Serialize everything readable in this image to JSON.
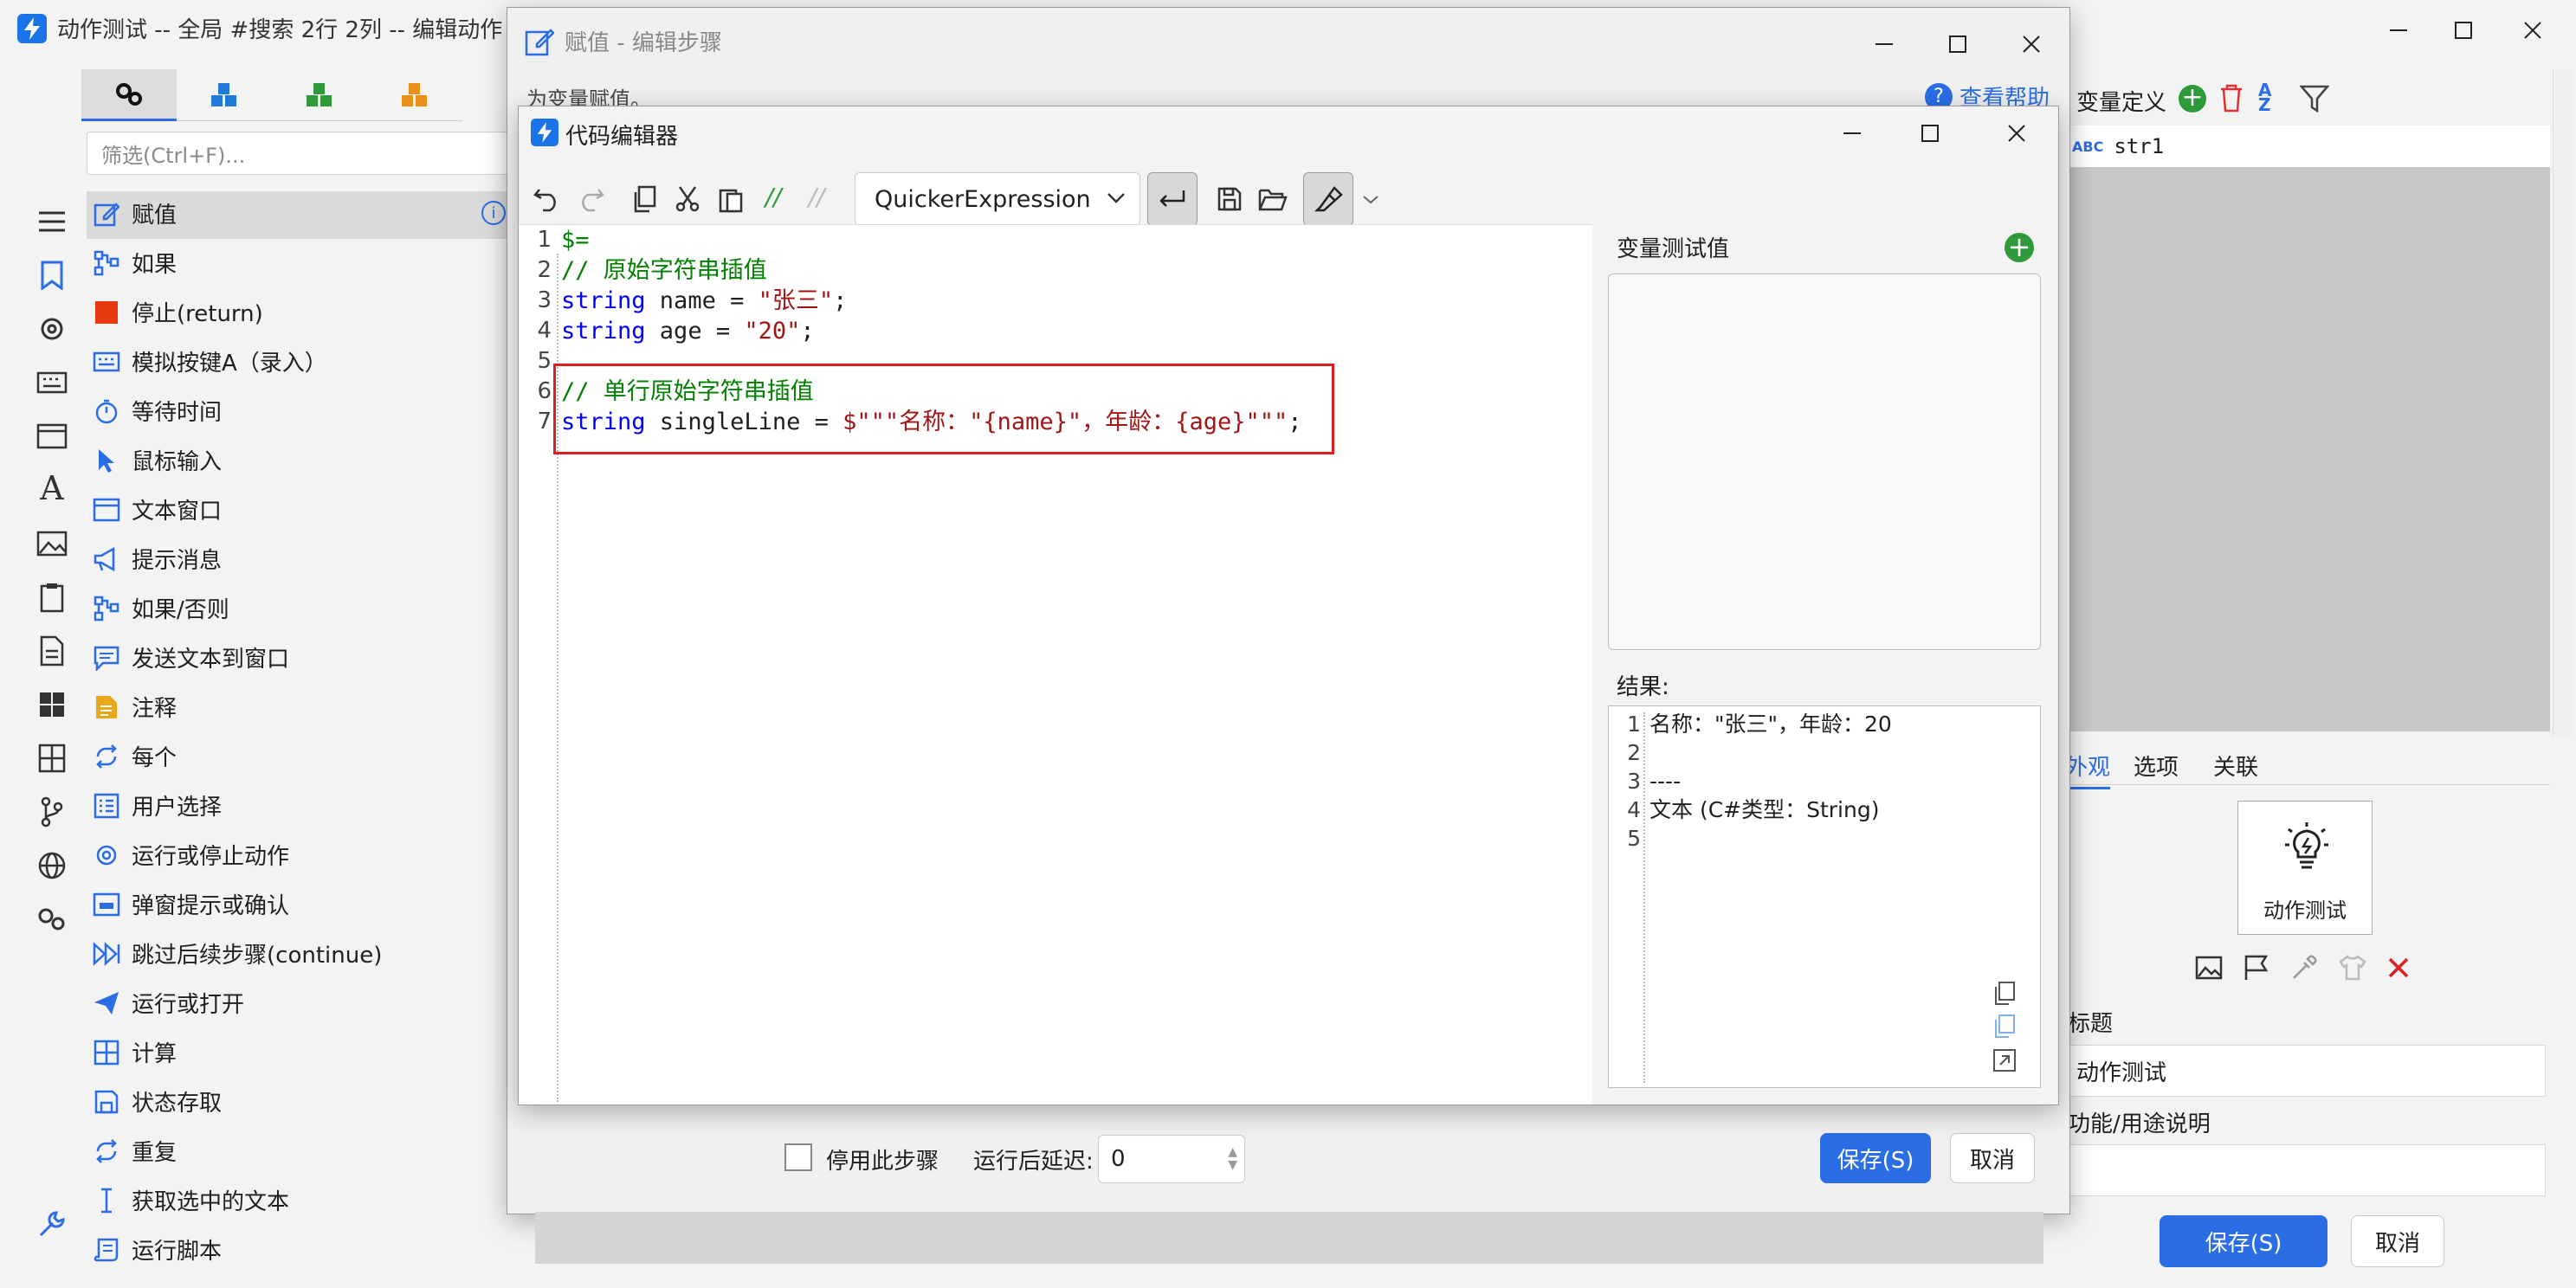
{
  "main_window": {
    "title": "动作测试 -- 全局 #搜索 2行 2列 -- 编辑动作",
    "filter_placeholder": "筛选(Ctrl+F)...",
    "toolbox_tabs": [
      "gears-tab",
      "cubes-blue-tab",
      "cubes-green-tab",
      "cubes-orange-tab"
    ],
    "steps": [
      {
        "label": "赋值",
        "icon": "pencil-icon"
      },
      {
        "label": "如果",
        "icon": "branch-icon"
      },
      {
        "label": "停止(return)",
        "icon": "stop-icon"
      },
      {
        "label": "模拟按键A（录入）",
        "icon": "keyboard-icon"
      },
      {
        "label": "等待时间",
        "icon": "timer-icon"
      },
      {
        "label": "鼠标输入",
        "icon": "cursor-icon"
      },
      {
        "label": "文本窗口",
        "icon": "window-icon"
      },
      {
        "label": "提示消息",
        "icon": "megaphone-icon"
      },
      {
        "label": "如果/否则",
        "icon": "branch-icon"
      },
      {
        "label": "发送文本到窗口",
        "icon": "message-icon"
      },
      {
        "label": "注释",
        "icon": "note-icon"
      },
      {
        "label": "每个",
        "icon": "loop-icon"
      },
      {
        "label": "用户选择",
        "icon": "list-icon"
      },
      {
        "label": "运行或停止动作",
        "icon": "gear-icon"
      },
      {
        "label": "弹窗提示或确认",
        "icon": "dialog-icon"
      },
      {
        "label": "跳过后续步骤(continue)",
        "icon": "skip-icon"
      },
      {
        "label": "运行或打开",
        "icon": "send-icon"
      },
      {
        "label": "计算",
        "icon": "calculator-icon"
      },
      {
        "label": "状态存取",
        "icon": "save-icon"
      },
      {
        "label": "重复",
        "icon": "loop-icon"
      },
      {
        "label": "获取选中的文本",
        "icon": "text-cursor-icon"
      },
      {
        "label": "运行脚本",
        "icon": "script-icon"
      }
    ],
    "var_panel_title": "变量定义",
    "variables": [
      {
        "type_badge": "ABC",
        "name": "str1"
      }
    ],
    "tabs": [
      "外观",
      "选项",
      "关联"
    ],
    "action_button_label": "动作测试",
    "title_label": "标题",
    "title_value": "动作测试",
    "desc_label": "功能/用途说明",
    "save": "保存(S)",
    "cancel": "取消"
  },
  "step_dialog": {
    "title": "赋值  -  编辑步骤",
    "subtitle": "为变量赋值。",
    "help_link": "查看帮助",
    "disable_step": "停用此步骤",
    "delay_label": "运行后延迟:",
    "delay_value": "0",
    "save": "保存(S)",
    "cancel": "取消"
  },
  "code_editor": {
    "title": "代码编辑器",
    "language": "QuickerExpression",
    "comment_btn": "//",
    "uncomment_btn": "//",
    "code_lines": [
      {
        "n": "1",
        "tokens": [
          {
            "t": "$=",
            "c": "cm"
          }
        ]
      },
      {
        "n": "2",
        "tokens": [
          {
            "t": "// 原始字符串插值",
            "c": "cm"
          }
        ]
      },
      {
        "n": "3",
        "tokens": [
          {
            "t": "string",
            "c": "kw"
          },
          {
            "t": " name = ",
            "c": ""
          },
          {
            "t": "\"张三\"",
            "c": "st"
          },
          {
            "t": ";",
            "c": ""
          }
        ]
      },
      {
        "n": "4",
        "tokens": [
          {
            "t": "string",
            "c": "kw"
          },
          {
            "t": " age = ",
            "c": ""
          },
          {
            "t": "\"20\"",
            "c": "st"
          },
          {
            "t": ";",
            "c": ""
          }
        ]
      },
      {
        "n": "5",
        "tokens": []
      },
      {
        "n": "6",
        "tokens": [
          {
            "t": "// 单行原始字符串插值",
            "c": "cm"
          }
        ]
      },
      {
        "n": "7",
        "tokens": [
          {
            "t": "string",
            "c": "kw"
          },
          {
            "t": " singleLine = ",
            "c": ""
          },
          {
            "t": "$\"\"\"名称：\"{name}\"，年龄：{age}\"\"\"",
            "c": "st"
          },
          {
            "t": ";",
            "c": ""
          }
        ]
      }
    ],
    "test_values_label": "变量测试值",
    "result_label": "结果:",
    "result_lines": [
      {
        "n": "1",
        "text": "名称：\"张三\"，年龄：20"
      },
      {
        "n": "2",
        "text": ""
      },
      {
        "n": "3",
        "text": "----"
      },
      {
        "n": "4",
        "text": "文本 (C#类型：String)"
      },
      {
        "n": "5",
        "text": ""
      }
    ]
  },
  "colors": {
    "accent": "#2b6de5",
    "highlight_box": "#e02020",
    "keyword": "#0000ff",
    "comment": "#008000",
    "string": "#a31515"
  }
}
